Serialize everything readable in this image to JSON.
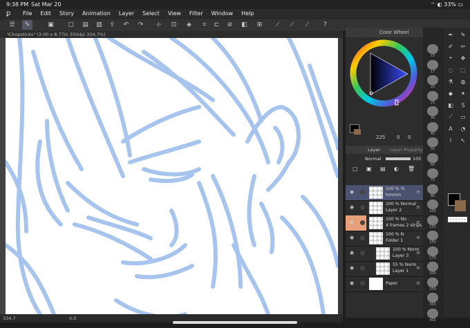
{
  "status": {
    "time": "9:38 PM",
    "date": "Sat Mar 20",
    "battery": "33%"
  },
  "menu": {
    "items": [
      "File",
      "Edit",
      "Story",
      "Animation",
      "Layer",
      "Select",
      "View",
      "Filter",
      "Window",
      "Help"
    ]
  },
  "document": {
    "tab_title": "\"Chopsticks\" (3.00 x 8.77in 350dpi 334.7%)"
  },
  "colors": {
    "stroke": "#a6c4ee",
    "active_layer": "#4a5270",
    "selected_layer": "#e8a07a",
    "main_color": "#000000",
    "sub_color": "#8a6a4a"
  },
  "bottom": {
    "zoom": "334.7",
    "rotation": "0.0"
  },
  "color_wheel": {
    "title": "Color Wheel",
    "value_a": "225",
    "value_b": "0",
    "value_c": "0"
  },
  "layer_panel": {
    "tab_layer": "Layer",
    "tab_property": "Layer Property",
    "blend_mode": "Normal",
    "opacity": "100",
    "layers": [
      {
        "name": "hmmm",
        "opacity": "100 %",
        "mode": "%",
        "active": true,
        "selected": false
      },
      {
        "name": "Layer 2",
        "opacity": "100 %",
        "mode": "Normal",
        "active": false,
        "selected": false
      },
      {
        "name": "4 frames 2 strips",
        "opacity": "100 %",
        "mode": "No",
        "active": false,
        "selected": true
      },
      {
        "name": "Folder 1",
        "opacity": "100 %",
        "mode": "N",
        "active": false,
        "selected": false
      },
      {
        "name": "Layer 3",
        "opacity": "100 %",
        "mode": "Norm",
        "active": false,
        "selected": false
      },
      {
        "name": "Layer 1",
        "opacity": "55 %",
        "mode": "Norm",
        "active": false,
        "selected": false
      },
      {
        "name": "Paper",
        "opacity": "",
        "mode": "",
        "active": false,
        "selected": false
      }
    ]
  },
  "brush_sizes": [
    "15",
    "17",
    "20",
    "25",
    "30",
    "40",
    "50",
    "60",
    "70",
    "80",
    "100",
    "120",
    "150",
    "170",
    "200",
    "250",
    "300",
    "400"
  ]
}
